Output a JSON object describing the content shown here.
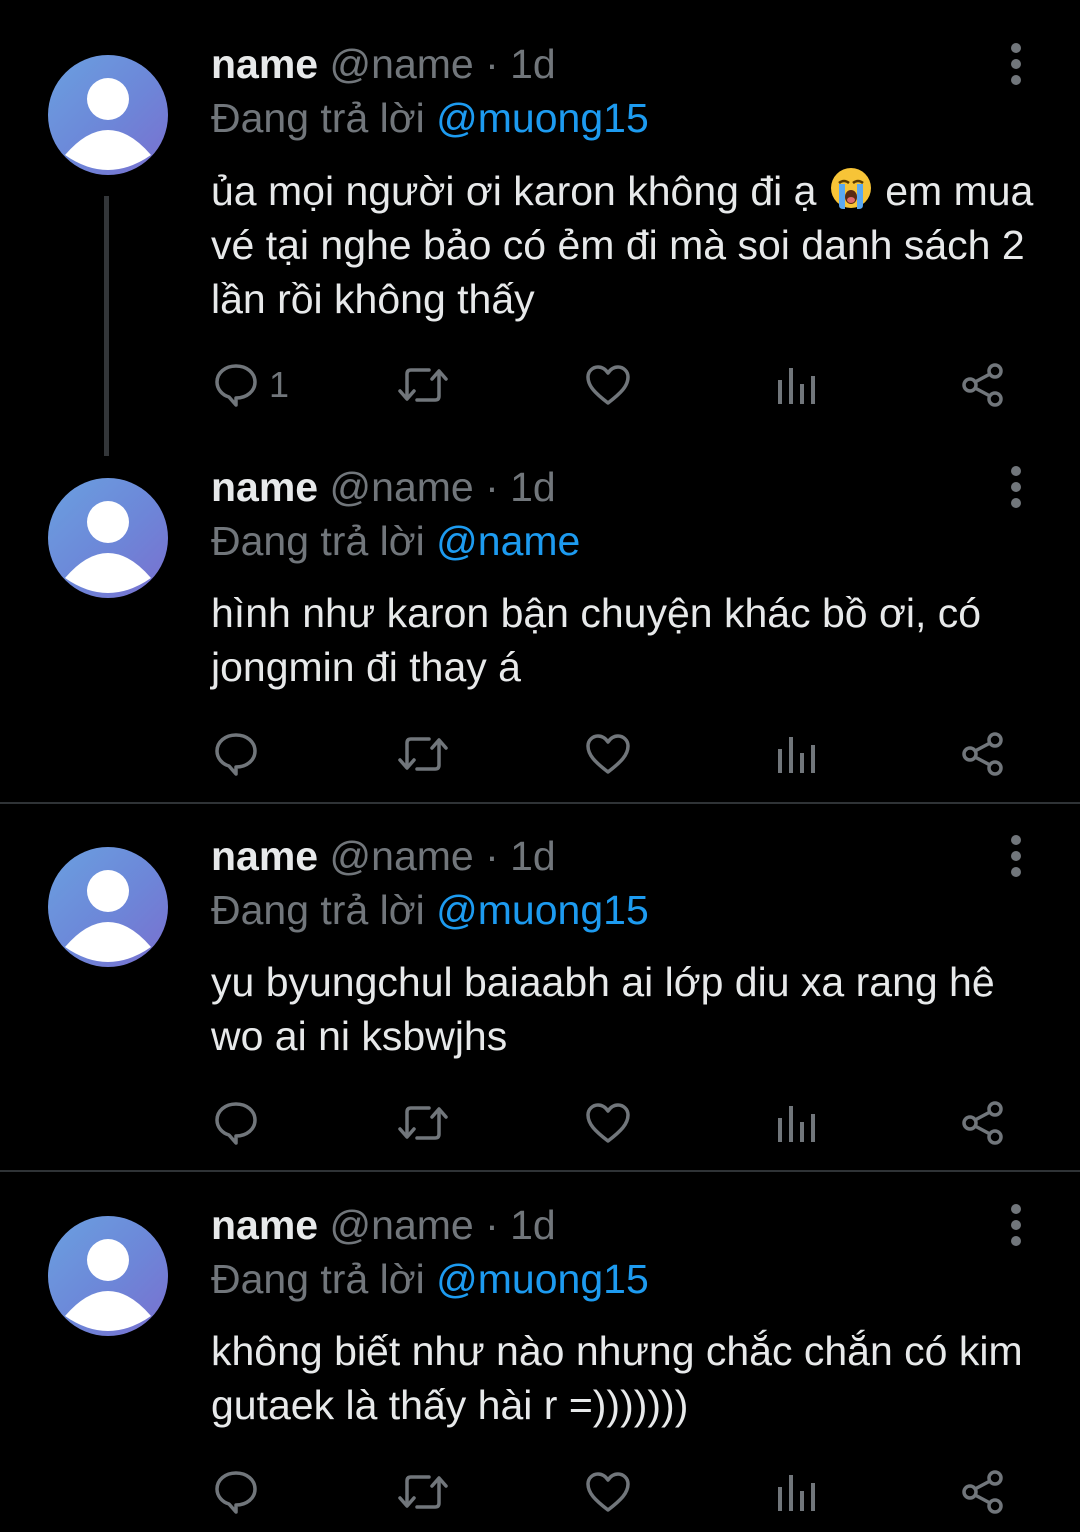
{
  "tweets": [
    {
      "name": "name",
      "meta": "@name · 1d",
      "reply_prefix": "Đang trả lời",
      "reply_to": "@muong15",
      "text_before_emoji": "ủa mọi người ơi karon không đi ạ",
      "emoji": "loudly-crying-face",
      "text_after_emoji": "em mua vé tại nghe bảo có ẻm đi mà soi danh sách 2 lần rồi không thấy",
      "reply_count": "1"
    },
    {
      "name": "name",
      "meta": "@name · 1d",
      "reply_prefix": "Đang trả lời",
      "reply_to": "@name",
      "text": "hình như karon bận chuyện khác bồ ơi, có jongmin đi thay á",
      "reply_count": ""
    },
    {
      "name": "name",
      "meta": "@name · 1d",
      "reply_prefix": "Đang trả lời",
      "reply_to": "@muong15",
      "text": "yu byungchul baiaabh ai lớp diu xa rang hê wo ai ni ksbwjhs",
      "reply_count": ""
    },
    {
      "name": "name",
      "meta": "@name · 1d",
      "reply_prefix": "Đang trả lời",
      "reply_to": "@muong15",
      "text": "không biết như nào nhưng chắc chắn có kim gutaek là thấy hài r =)))))))",
      "reply_count": ""
    }
  ],
  "icons": {
    "reply": "reply-icon",
    "retweet": "retweet-icon",
    "like": "heart-icon",
    "views": "views-icon",
    "share": "share-icon",
    "more": "more-vertical-icon"
  },
  "colors": {
    "background": "#000000",
    "text": "#e7e9ea",
    "secondary": "#71767b",
    "mention": "#1d9bf0",
    "divider": "#2f3336",
    "avatar": "#6d86d8"
  }
}
